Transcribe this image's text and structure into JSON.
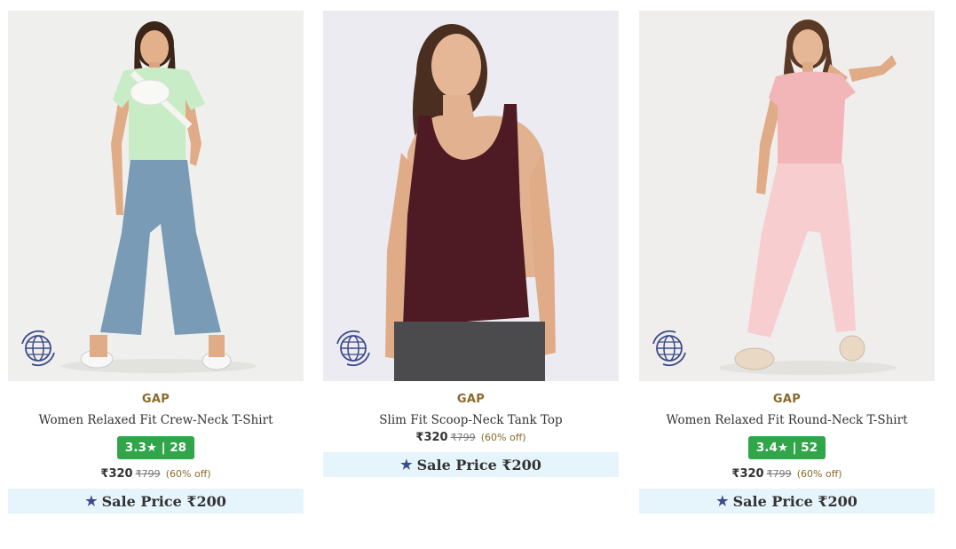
{
  "products": [
    {
      "brand": "GAP",
      "name": "Women Relaxed Fit Crew-Neck T-Shirt",
      "rating": "3.3★ | 28",
      "price": "₹320",
      "mrp": "₹799",
      "discount": "(60% off)",
      "sale_label": "Sale Price ₹200",
      "background": "#efefed",
      "top_color": "#c8ecc5",
      "bottom_color": "#7a9bb5"
    },
    {
      "brand": "GAP",
      "name": "Slim Fit Scoop-Neck Tank Top",
      "rating": "",
      "price": "₹320",
      "mrp": "₹799",
      "discount": "(60% off)",
      "sale_label": "Sale Price ₹200",
      "background": "#ebebf1",
      "top_color": "#4e1a24",
      "bottom_color": "#4b4b4d"
    },
    {
      "brand": "GAP",
      "name": "Women Relaxed Fit Round-Neck T-Shirt",
      "rating": "3.4★ | 52",
      "price": "₹320",
      "mrp": "₹799",
      "discount": "(60% off)",
      "sale_label": "Sale Price ₹200",
      "background": "#efeeec",
      "top_color": "#f2b6b8",
      "bottom_color": "#f7cdd0"
    }
  ],
  "icons": {
    "view_360": "globe-icon",
    "sale": "star-icon"
  },
  "colors": {
    "rating_badge": "#30a54a",
    "sale_bar": "#e6f5fb",
    "brand_text": "#8b6a2b",
    "star": "#3d4a8c"
  }
}
